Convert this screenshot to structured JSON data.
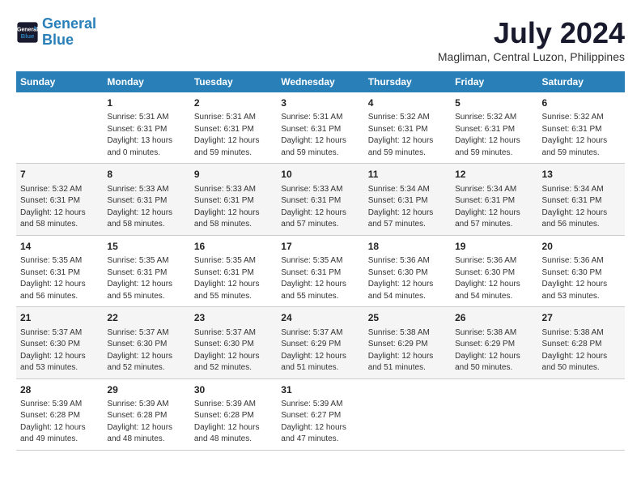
{
  "logo": {
    "line1": "General",
    "line2": "Blue"
  },
  "title": "July 2024",
  "subtitle": "Magliman, Central Luzon, Philippines",
  "days_header": [
    "Sunday",
    "Monday",
    "Tuesday",
    "Wednesday",
    "Thursday",
    "Friday",
    "Saturday"
  ],
  "weeks": [
    [
      {
        "num": "",
        "info": ""
      },
      {
        "num": "1",
        "info": "Sunrise: 5:31 AM\nSunset: 6:31 PM\nDaylight: 13 hours\nand 0 minutes."
      },
      {
        "num": "2",
        "info": "Sunrise: 5:31 AM\nSunset: 6:31 PM\nDaylight: 12 hours\nand 59 minutes."
      },
      {
        "num": "3",
        "info": "Sunrise: 5:31 AM\nSunset: 6:31 PM\nDaylight: 12 hours\nand 59 minutes."
      },
      {
        "num": "4",
        "info": "Sunrise: 5:32 AM\nSunset: 6:31 PM\nDaylight: 12 hours\nand 59 minutes."
      },
      {
        "num": "5",
        "info": "Sunrise: 5:32 AM\nSunset: 6:31 PM\nDaylight: 12 hours\nand 59 minutes."
      },
      {
        "num": "6",
        "info": "Sunrise: 5:32 AM\nSunset: 6:31 PM\nDaylight: 12 hours\nand 59 minutes."
      }
    ],
    [
      {
        "num": "7",
        "info": "Sunrise: 5:32 AM\nSunset: 6:31 PM\nDaylight: 12 hours\nand 58 minutes."
      },
      {
        "num": "8",
        "info": "Sunrise: 5:33 AM\nSunset: 6:31 PM\nDaylight: 12 hours\nand 58 minutes."
      },
      {
        "num": "9",
        "info": "Sunrise: 5:33 AM\nSunset: 6:31 PM\nDaylight: 12 hours\nand 58 minutes."
      },
      {
        "num": "10",
        "info": "Sunrise: 5:33 AM\nSunset: 6:31 PM\nDaylight: 12 hours\nand 57 minutes."
      },
      {
        "num": "11",
        "info": "Sunrise: 5:34 AM\nSunset: 6:31 PM\nDaylight: 12 hours\nand 57 minutes."
      },
      {
        "num": "12",
        "info": "Sunrise: 5:34 AM\nSunset: 6:31 PM\nDaylight: 12 hours\nand 57 minutes."
      },
      {
        "num": "13",
        "info": "Sunrise: 5:34 AM\nSunset: 6:31 PM\nDaylight: 12 hours\nand 56 minutes."
      }
    ],
    [
      {
        "num": "14",
        "info": "Sunrise: 5:35 AM\nSunset: 6:31 PM\nDaylight: 12 hours\nand 56 minutes."
      },
      {
        "num": "15",
        "info": "Sunrise: 5:35 AM\nSunset: 6:31 PM\nDaylight: 12 hours\nand 55 minutes."
      },
      {
        "num": "16",
        "info": "Sunrise: 5:35 AM\nSunset: 6:31 PM\nDaylight: 12 hours\nand 55 minutes."
      },
      {
        "num": "17",
        "info": "Sunrise: 5:35 AM\nSunset: 6:31 PM\nDaylight: 12 hours\nand 55 minutes."
      },
      {
        "num": "18",
        "info": "Sunrise: 5:36 AM\nSunset: 6:30 PM\nDaylight: 12 hours\nand 54 minutes."
      },
      {
        "num": "19",
        "info": "Sunrise: 5:36 AM\nSunset: 6:30 PM\nDaylight: 12 hours\nand 54 minutes."
      },
      {
        "num": "20",
        "info": "Sunrise: 5:36 AM\nSunset: 6:30 PM\nDaylight: 12 hours\nand 53 minutes."
      }
    ],
    [
      {
        "num": "21",
        "info": "Sunrise: 5:37 AM\nSunset: 6:30 PM\nDaylight: 12 hours\nand 53 minutes."
      },
      {
        "num": "22",
        "info": "Sunrise: 5:37 AM\nSunset: 6:30 PM\nDaylight: 12 hours\nand 52 minutes."
      },
      {
        "num": "23",
        "info": "Sunrise: 5:37 AM\nSunset: 6:30 PM\nDaylight: 12 hours\nand 52 minutes."
      },
      {
        "num": "24",
        "info": "Sunrise: 5:37 AM\nSunset: 6:29 PM\nDaylight: 12 hours\nand 51 minutes."
      },
      {
        "num": "25",
        "info": "Sunrise: 5:38 AM\nSunset: 6:29 PM\nDaylight: 12 hours\nand 51 minutes."
      },
      {
        "num": "26",
        "info": "Sunrise: 5:38 AM\nSunset: 6:29 PM\nDaylight: 12 hours\nand 50 minutes."
      },
      {
        "num": "27",
        "info": "Sunrise: 5:38 AM\nSunset: 6:28 PM\nDaylight: 12 hours\nand 50 minutes."
      }
    ],
    [
      {
        "num": "28",
        "info": "Sunrise: 5:39 AM\nSunset: 6:28 PM\nDaylight: 12 hours\nand 49 minutes."
      },
      {
        "num": "29",
        "info": "Sunrise: 5:39 AM\nSunset: 6:28 PM\nDaylight: 12 hours\nand 48 minutes."
      },
      {
        "num": "30",
        "info": "Sunrise: 5:39 AM\nSunset: 6:28 PM\nDaylight: 12 hours\nand 48 minutes."
      },
      {
        "num": "31",
        "info": "Sunrise: 5:39 AM\nSunset: 6:27 PM\nDaylight: 12 hours\nand 47 minutes."
      },
      {
        "num": "",
        "info": ""
      },
      {
        "num": "",
        "info": ""
      },
      {
        "num": "",
        "info": ""
      }
    ]
  ]
}
